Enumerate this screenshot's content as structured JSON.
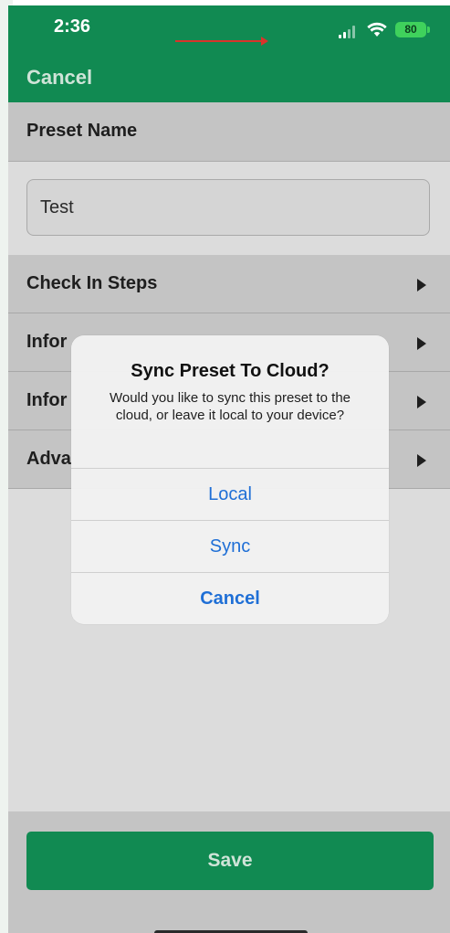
{
  "status_bar": {
    "time": "2:36",
    "battery": "80"
  },
  "nav": {
    "cancel_label": "Cancel"
  },
  "section": {
    "header": "Preset Name"
  },
  "preset_name_input": {
    "value": "Test"
  },
  "menu": {
    "items": [
      {
        "label": "Check In Steps",
        "icon": "chevron-right-icon"
      },
      {
        "label": "Infor",
        "icon": "chevron-right-icon"
      },
      {
        "label": "Infor",
        "icon": "chevron-right-icon"
      },
      {
        "label": "Adva",
        "icon": "chevron-right-icon"
      }
    ]
  },
  "footer": {
    "save_label": "Save"
  },
  "dialog": {
    "title": "Sync Preset To Cloud?",
    "message": "Would you like to sync this preset to the cloud, or leave it local to your device?",
    "buttons": {
      "local": "Local",
      "sync": "Sync",
      "cancel": "Cancel"
    }
  },
  "colors": {
    "brand_green": "#118a52",
    "dialog_action_blue": "#1f6fd6",
    "annotation_red": "#d9342b"
  }
}
